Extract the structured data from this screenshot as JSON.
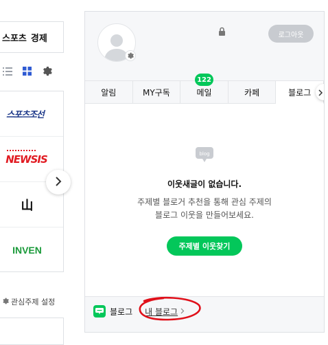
{
  "left": {
    "topics": [
      "스포츠",
      "경제"
    ],
    "press": [
      {
        "name": "스포츠조선"
      },
      {
        "name": "NEWSIS"
      },
      {
        "name": "山"
      },
      {
        "name": "INVEN"
      }
    ],
    "interest_label": "관심주제 설정"
  },
  "panel": {
    "logout_label": "로그아웃",
    "tabs": [
      {
        "label": "알림"
      },
      {
        "label": "MY구독"
      },
      {
        "label": "메일"
      },
      {
        "label": "카페"
      },
      {
        "label": "블로그"
      }
    ],
    "mail_count": "122",
    "blog_icon_text": "blog",
    "empty_title": "이웃새글이 없습니다.",
    "empty_desc_line1": "주제별 블로거 추천을 통해 관심 주제의",
    "empty_desc_line2": "블로그 이웃을 만들어보세요.",
    "find_button": "주제별 이웃찾기",
    "footer_label": "블로그",
    "my_blog_link": "내 블로그"
  },
  "colors": {
    "accent": "#03c75a",
    "logout_bg": "#c8cbd0",
    "annotation": "#e0101a"
  }
}
